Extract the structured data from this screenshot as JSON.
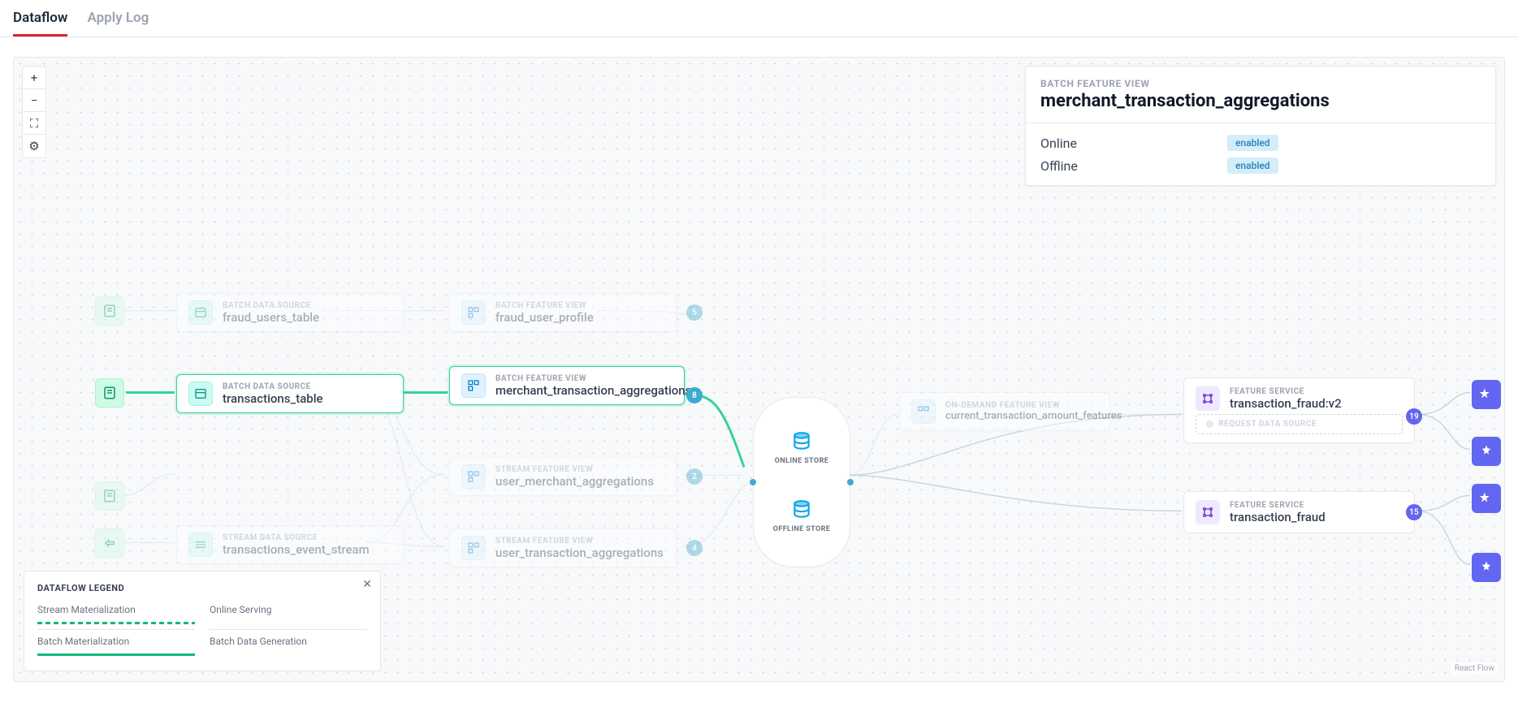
{
  "tabs": {
    "dataflow": "Dataflow",
    "apply_log": "Apply Log"
  },
  "info": {
    "subtitle": "BATCH FEATURE VIEW",
    "title": "merchant_transaction_aggregations",
    "online_label": "Online",
    "offline_label": "Offline",
    "enabled": "enabled"
  },
  "legend": {
    "title": "DATAFLOW LEGEND",
    "stream_mat": "Stream Materialization",
    "online_serving": "Online Serving",
    "batch_mat": "Batch Materialization",
    "batch_gen": "Batch Data Generation"
  },
  "store": {
    "online": "ONLINE STORE",
    "offline": "OFFLINE STORE"
  },
  "nodes": {
    "ds_fraud_users": {
      "type": "BATCH DATA SOURCE",
      "name": "fraud_users_table"
    },
    "ds_transactions": {
      "type": "BATCH DATA SOURCE",
      "name": "transactions_table"
    },
    "ds_event_stream": {
      "type": "STREAM DATA SOURCE",
      "name": "transactions_event_stream"
    },
    "fv_fraud_profile": {
      "type": "BATCH FEATURE VIEW",
      "name": "fraud_user_profile"
    },
    "fv_merchant_agg": {
      "type": "BATCH FEATURE VIEW",
      "name": "merchant_transaction_aggregations"
    },
    "fv_user_merch": {
      "type": "STREAM FEATURE VIEW",
      "name": "user_merchant_aggregations"
    },
    "fv_user_txn": {
      "type": "STREAM FEATURE VIEW",
      "name": "user_transaction_aggregations"
    },
    "fv_odfv": {
      "type": "ON-DEMAND FEATURE VIEW",
      "name": "current_transaction_amount_features"
    },
    "fs_v2": {
      "type": "FEATURE SERVICE",
      "name": "transaction_fraud:v2",
      "req": "REQUEST DATA SOURCE"
    },
    "fs_v1": {
      "type": "FEATURE SERVICE",
      "name": "transaction_fraud"
    }
  },
  "counts": {
    "merchant": "8",
    "fraud_profile": "5",
    "user_merch": "2",
    "user_txn": "4",
    "fs_v2": "19",
    "fs_v1": "15"
  },
  "attr": "React Flow"
}
